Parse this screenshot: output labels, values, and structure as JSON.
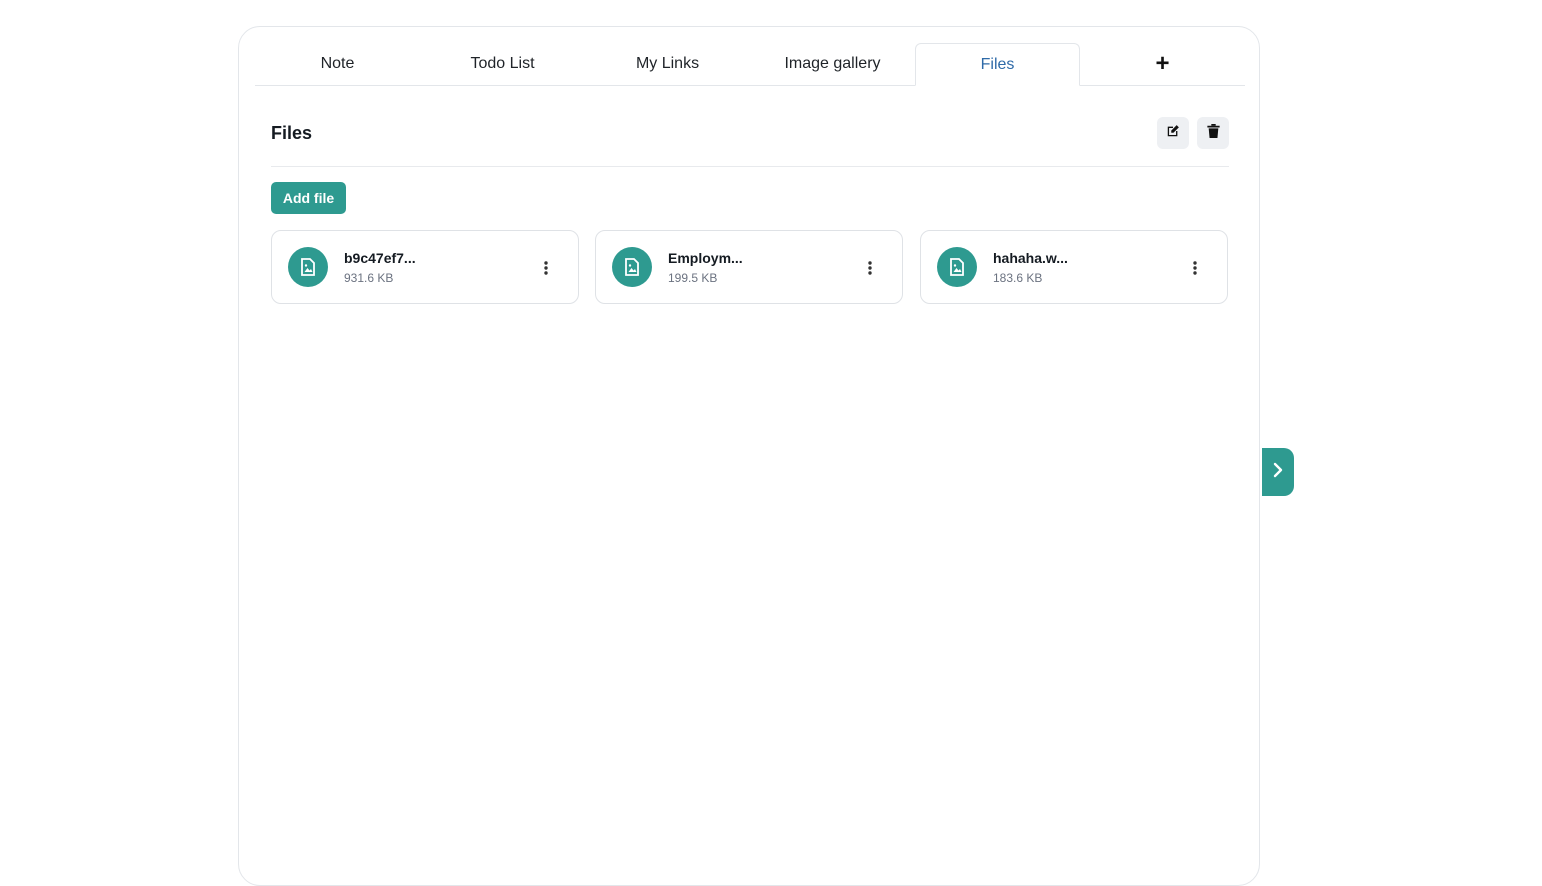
{
  "tabs": [
    {
      "label": "Note"
    },
    {
      "label": "Todo List"
    },
    {
      "label": "My Links"
    },
    {
      "label": "Image gallery"
    },
    {
      "label": "Files",
      "active": true
    }
  ],
  "add_tab_label": "+",
  "section": {
    "title": "Files",
    "edit_icon": "edit-icon",
    "delete_icon": "trash-icon"
  },
  "add_file_label": "Add file",
  "files": [
    {
      "name": "b9c47ef7...",
      "size": "931.6 KB",
      "icon": "image-file-icon"
    },
    {
      "name": "Employm...",
      "size": "199.5 KB",
      "icon": "image-file-icon"
    },
    {
      "name": "hahaha.w...",
      "size": "183.6 KB",
      "icon": "image-file-icon"
    }
  ],
  "colors": {
    "accent": "#2e9a90",
    "active_tab_text": "#2e6aa8",
    "border": "#e3e6ea"
  }
}
